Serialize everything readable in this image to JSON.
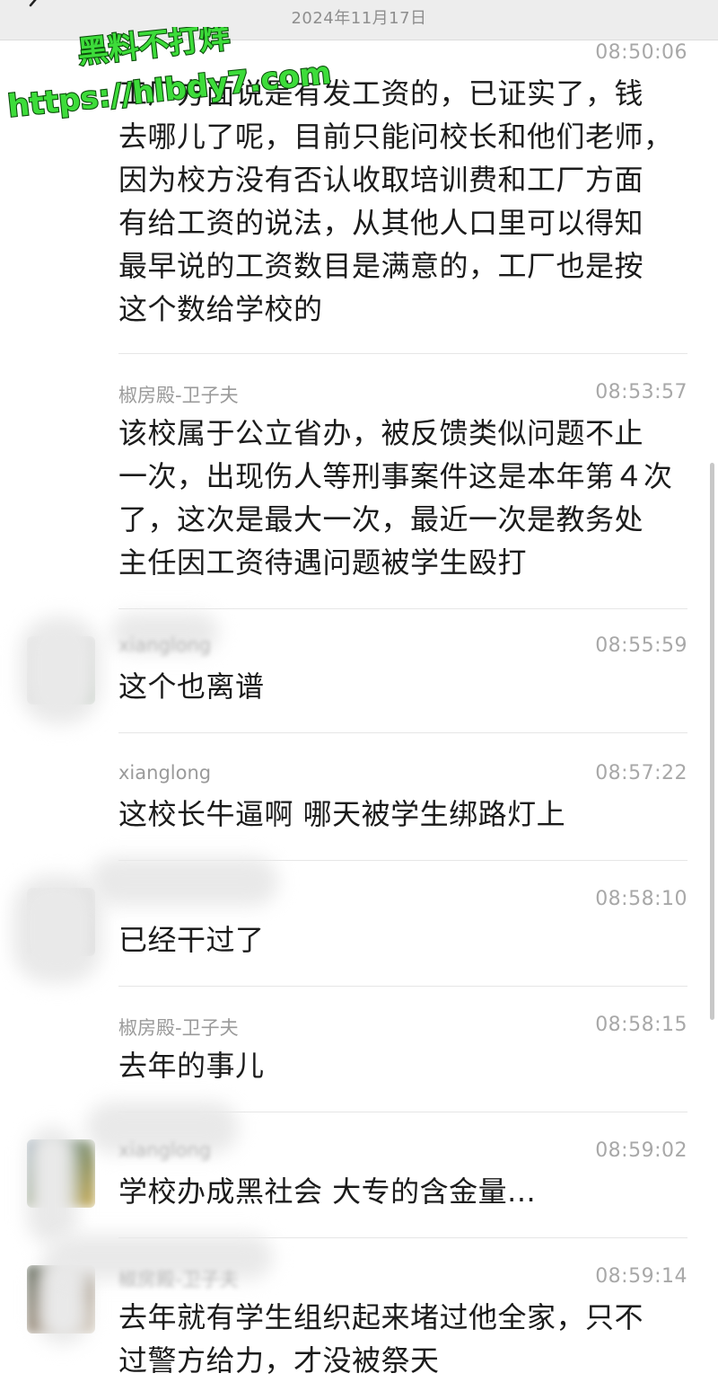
{
  "header": {
    "date": "2024年11月17日",
    "back_icon": "chevron-left-icon"
  },
  "watermark": {
    "line1": "黑料不打烊",
    "line2": "https://hlbdy7.com",
    "color": "#3ddc3a"
  },
  "messages": [
    {
      "name": "",
      "time": "08:50:06",
      "text": "工厂方面说是有发工资的，已证实了，钱\n去哪儿了呢，目前只能问校长和他们老师，\n因为校方没有否认收取培训费和工厂方面\n有给工资的说法，从其他人口里可以得知\n最早说的工资数目是满意的，工厂也是按\n这个数给学校的"
    },
    {
      "name": "椒房殿-卫子夫",
      "time": "08:53:57",
      "text": "该校属于公立省办，被反馈类似问题不止\n一次，出现伤人等刑事案件这是本年第４次\n了，这次是最大一次，最近一次是教务处\n主任因工资待遇问题被学生殴打"
    },
    {
      "name": "xianglong",
      "time": "08:55:59",
      "text": "这个也离谱"
    },
    {
      "name": "xianglong",
      "time": "08:57:22",
      "text": "这校长牛逼啊 哪天被学生绑路灯上"
    },
    {
      "name": "",
      "time": "08:58:10",
      "text": "已经干过了"
    },
    {
      "name": "椒房殿-卫子夫",
      "time": "08:58:15",
      "text": "去年的事儿"
    },
    {
      "name": "xianglong",
      "time": "08:59:02",
      "text": "学校办成黑社会 大专的含金量..."
    },
    {
      "name": "椒房殿-卫子夫",
      "time": "08:59:14",
      "text": "去年就有学生组织起来堵过他全家，只不\n过警方给力，才没被祭天"
    }
  ]
}
